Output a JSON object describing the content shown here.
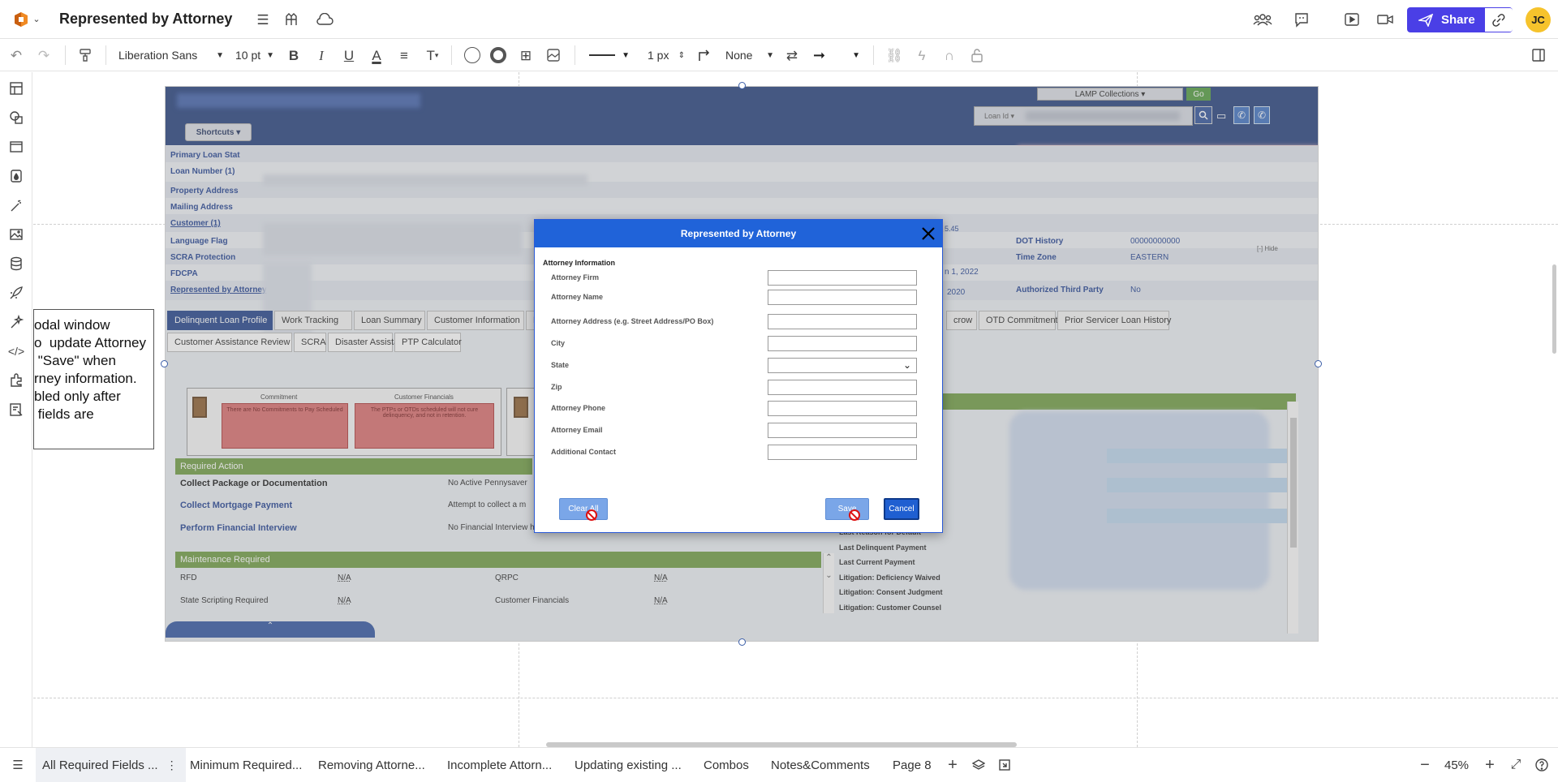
{
  "app": {
    "doc_title": "Represented by Attorney",
    "share_label": "Share",
    "avatar_initials": "JC",
    "accent_color": "#4a3fe6"
  },
  "toolbar": {
    "font_family": "Liberation Sans",
    "font_size": "10 pt",
    "line_width": "1 px",
    "arrow_start": "None"
  },
  "screenshot": {
    "top_dropdown": "LAMP Collections ▾",
    "go_label": "Go",
    "loan_id_label": "Loan Id ▾",
    "shortcuts_label": "Shortcuts ▾",
    "info_rows": [
      {
        "label": "Primary Loan Stat"
      },
      {
        "label": "Loan Number (1)"
      },
      {
        "label": "Property Address"
      },
      {
        "label": "Mailing Address"
      },
      {
        "label": "Customer (1)"
      },
      {
        "label": "Language Flag"
      },
      {
        "label": "SCRA Protection"
      },
      {
        "label": "FDCPA"
      },
      {
        "label": "Represented by Attorney"
      }
    ],
    "right_info": [
      {
        "label": "DOT History",
        "value": "00000000000"
      },
      {
        "label": "Time Zone",
        "value": "EASTERN"
      },
      {
        "label": "Authorized Third Party",
        "value": "No"
      }
    ],
    "partial_dates": [
      "n 1, 2022",
      "2020",
      "5.45"
    ],
    "hide_label": "[-] Hide",
    "tabs_row1": [
      "Delinquent Loan Profile",
      "Work Tracking",
      "Loan Summary",
      "Customer Information",
      "D"
    ],
    "tabs_row1_right": [
      "crow",
      "OTD Commitment",
      "Prior Servicer Loan History"
    ],
    "tabs_row2": [
      "Customer Assistance Review",
      "SCRA",
      "Disaster Assistance",
      "PTP Calculator"
    ],
    "card_commitment_title": "Commitment",
    "card_commitment_text": "There are No Commitments to Pay Scheduled",
    "card_financials_title": "Customer Financials",
    "card_financials_text": "The PTPs or OTDs scheduled will not cure delinquency, and not in retention.",
    "required_action_title": "Required Action",
    "required_actions": [
      {
        "name": "Collect Package or Documentation",
        "desc": "No Active Pennysaver"
      },
      {
        "name": "Collect Mortgage Payment",
        "desc": "Attempt to collect a m"
      },
      {
        "name": "Perform Financial Interview",
        "desc": "No Financial Interview has been performed, or the existing interview is no longer valid"
      }
    ],
    "maintenance_title": "Maintenance Required",
    "maintenance_rows": [
      {
        "a": "RFD",
        "b": "N/A",
        "c": "QRPC",
        "d": "N/A"
      },
      {
        "a": "State Scripting Required",
        "b": "N/A",
        "c": "Customer Financials",
        "d": "N/A"
      }
    ],
    "right_list": [
      "Last Reason for Default",
      "Last Delinquent Payment",
      "Last Current Payment",
      "Litigation: Deficiency Waived",
      "Litigation: Consent Judgment",
      "Litigation: Customer Counsel"
    ]
  },
  "modal": {
    "title": "Represented by Attorney",
    "section": "Attorney Information",
    "fields": [
      {
        "label": "Attorney Firm"
      },
      {
        "label": "Attorney Name"
      },
      {
        "label": "Attorney Address (e.g. Street Address/PO  Box)"
      },
      {
        "label": "City"
      },
      {
        "label": "State"
      },
      {
        "label": "Zip"
      },
      {
        "label": "Attorney Phone"
      },
      {
        "label": "Attorney Email"
      },
      {
        "label": "Additional Contact"
      }
    ],
    "clear_label": "Clear All",
    "save_label": "Save",
    "cancel_label": "Cancel"
  },
  "note": {
    "lines": [
      "odal window",
      "o  update Attorney",
      " \"Save\" when",
      "rney information.",
      "bled only after",
      " fields are"
    ]
  },
  "pages": {
    "tabs": [
      "All Required Fields ...",
      "Minimum Required...",
      "Removing Attorne...",
      "Incomplete Attorn...",
      "Updating existing ...",
      "Combos",
      "Notes&Comments",
      "Page 8"
    ],
    "zoom": "45%"
  }
}
